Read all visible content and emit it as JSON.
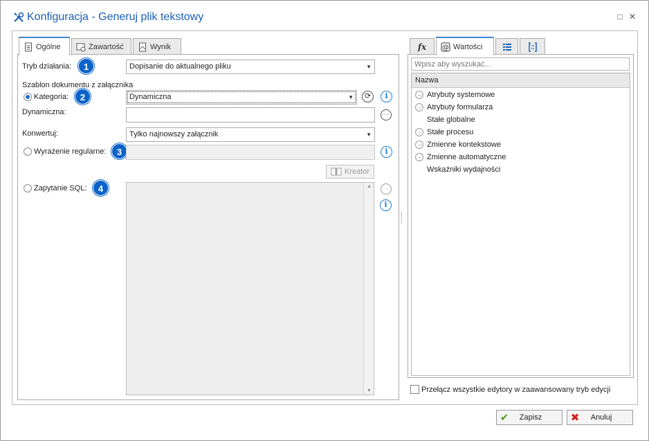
{
  "window": {
    "title": "Konfiguracja - Generuj plik tekstowy",
    "maximize_glyph": "□",
    "close_glyph": "✕"
  },
  "left_tabs": [
    {
      "label": "Ogólne",
      "icon": "document-icon",
      "active": true
    },
    {
      "label": "Zawartość",
      "icon": "content-settings-icon",
      "active": false
    },
    {
      "label": "Wynik",
      "icon": "pdf-result-icon",
      "active": false
    }
  ],
  "form": {
    "mode_label": "Tryb działania:",
    "mode_value": "Dopisanie do aktualnego pliku",
    "section_label": "Szablon dokumentu z załącznika",
    "category_label": "Kategoria:",
    "category_value": "Dynamiczna",
    "dynamic_label": "Dynamiczna:",
    "dynamic_value": "",
    "convert_label": "Konwertuj:",
    "convert_value": "Tylko najnowszy załącznik",
    "regex_label": "Wyrażenie regularne:",
    "regex_value": "",
    "creator_label": "Kreator",
    "sql_label": "Zapytanie SQL:",
    "sql_value": ""
  },
  "badges": [
    "1",
    "2",
    "3",
    "4"
  ],
  "right_tabs": [
    {
      "label": "",
      "icon": "function-icon",
      "glyph": "fx"
    },
    {
      "label": "Wartości",
      "icon": "values-icon",
      "active": true
    },
    {
      "label": "",
      "icon": "list-icon"
    },
    {
      "label": "",
      "icon": "bracket-icon"
    }
  ],
  "values_panel": {
    "search_placeholder": "Wpisz aby wyszukać...",
    "column_header": "Nazwa",
    "items": [
      {
        "label": "Atrybuty systemowe",
        "expandable": true
      },
      {
        "label": "Atrybuty formularza",
        "expandable": true
      },
      {
        "label": "Stałe globalne",
        "expandable": false
      },
      {
        "label": "Stałe procesu",
        "expandable": true
      },
      {
        "label": "Zmienne kontekstowe",
        "expandable": true
      },
      {
        "label": "Zmienne automatyczne",
        "expandable": true
      },
      {
        "label": "Wskaźniki wydajności",
        "expandable": false
      }
    ]
  },
  "advanced_toggle_label": "Przełącz wszystkie edytory w zaawansowany tryb edycji",
  "footer": {
    "save_label": "Zapisz",
    "cancel_label": "Anuluj"
  },
  "colors": {
    "title": "#1a5fb4",
    "badge": "#0b63c9",
    "info": "#1a7fd6",
    "save_check": "#4a9b1f",
    "cancel_x": "#d42020"
  }
}
